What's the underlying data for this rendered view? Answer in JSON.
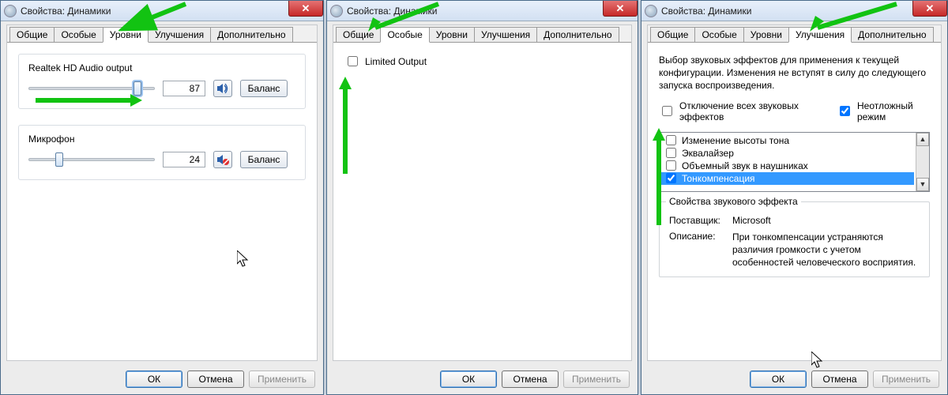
{
  "title": "Свойства: Динамики",
  "closeGlyph": "✕",
  "tabs": {
    "general": "Общие",
    "custom": "Особые",
    "levels": "Уровни",
    "enhance": "Улучшения",
    "advanced": "Дополнительно"
  },
  "buttons": {
    "ok": "ОК",
    "cancel": "Отмена",
    "apply": "Применить",
    "balance": "Баланс"
  },
  "levels": {
    "device1": {
      "label": "Realtek HD Audio output",
      "value": "87",
      "thumbPct": 87
    },
    "device2": {
      "label": "Микрофон",
      "value": "24",
      "thumbPct": 24
    }
  },
  "custom": {
    "limitedOutput": "Limited Output"
  },
  "enhance": {
    "intro": "Выбор звуковых эффектов для применения к текущей конфигурации. Изменения не вступят в силу до следующего запуска воспроизведения.",
    "disableAll": "Отключение всех звуковых эффектов",
    "immediate": "Неотложный режим",
    "effects": {
      "pitch": "Изменение высоты тона",
      "eq": "Эквалайзер",
      "surround": "Объемный звук в наушниках",
      "loudness": "Тонкомпенсация"
    },
    "propsTitle": "Свойства звукового эффекта",
    "vendorLabel": "Поставщик:",
    "vendor": "Microsoft",
    "descLabel": "Описание:",
    "desc": "При тонкомпенсации устраняются различия громкости с учетом особенностей человеческого восприятия."
  }
}
